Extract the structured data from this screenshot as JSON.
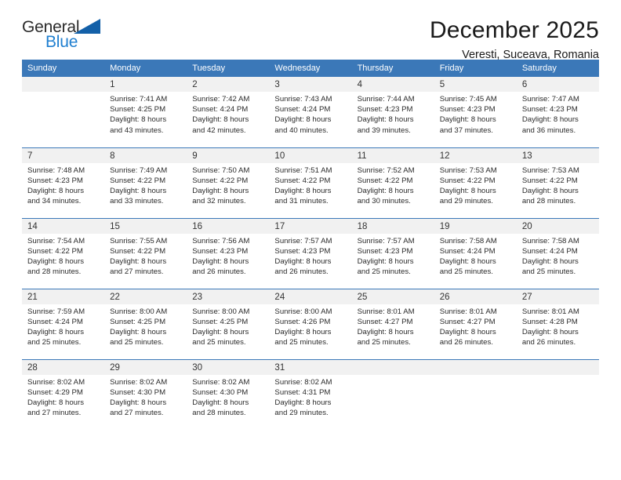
{
  "logo": {
    "word_top": "General",
    "word_bottom": "Blue",
    "icon": "blue-triangle-flag"
  },
  "header": {
    "title": "December 2025",
    "subtitle": "Veresti, Suceava, Romania"
  },
  "colors": {
    "header_blue": "#3b78b8",
    "logo_blue": "#1f7fd0",
    "daynum_band": "#f1f1f1"
  },
  "weekday_headers": [
    "Sunday",
    "Monday",
    "Tuesday",
    "Wednesday",
    "Thursday",
    "Friday",
    "Saturday"
  ],
  "weeks": [
    [
      {
        "day": "",
        "sunrise": "",
        "sunset": "",
        "daylight_l1": "",
        "daylight_l2": ""
      },
      {
        "day": "1",
        "sunrise": "Sunrise: 7:41 AM",
        "sunset": "Sunset: 4:25 PM",
        "daylight_l1": "Daylight: 8 hours",
        "daylight_l2": "and 43 minutes."
      },
      {
        "day": "2",
        "sunrise": "Sunrise: 7:42 AM",
        "sunset": "Sunset: 4:24 PM",
        "daylight_l1": "Daylight: 8 hours",
        "daylight_l2": "and 42 minutes."
      },
      {
        "day": "3",
        "sunrise": "Sunrise: 7:43 AM",
        "sunset": "Sunset: 4:24 PM",
        "daylight_l1": "Daylight: 8 hours",
        "daylight_l2": "and 40 minutes."
      },
      {
        "day": "4",
        "sunrise": "Sunrise: 7:44 AM",
        "sunset": "Sunset: 4:23 PM",
        "daylight_l1": "Daylight: 8 hours",
        "daylight_l2": "and 39 minutes."
      },
      {
        "day": "5",
        "sunrise": "Sunrise: 7:45 AM",
        "sunset": "Sunset: 4:23 PM",
        "daylight_l1": "Daylight: 8 hours",
        "daylight_l2": "and 37 minutes."
      },
      {
        "day": "6",
        "sunrise": "Sunrise: 7:47 AM",
        "sunset": "Sunset: 4:23 PM",
        "daylight_l1": "Daylight: 8 hours",
        "daylight_l2": "and 36 minutes."
      }
    ],
    [
      {
        "day": "7",
        "sunrise": "Sunrise: 7:48 AM",
        "sunset": "Sunset: 4:23 PM",
        "daylight_l1": "Daylight: 8 hours",
        "daylight_l2": "and 34 minutes."
      },
      {
        "day": "8",
        "sunrise": "Sunrise: 7:49 AM",
        "sunset": "Sunset: 4:22 PM",
        "daylight_l1": "Daylight: 8 hours",
        "daylight_l2": "and 33 minutes."
      },
      {
        "day": "9",
        "sunrise": "Sunrise: 7:50 AM",
        "sunset": "Sunset: 4:22 PM",
        "daylight_l1": "Daylight: 8 hours",
        "daylight_l2": "and 32 minutes."
      },
      {
        "day": "10",
        "sunrise": "Sunrise: 7:51 AM",
        "sunset": "Sunset: 4:22 PM",
        "daylight_l1": "Daylight: 8 hours",
        "daylight_l2": "and 31 minutes."
      },
      {
        "day": "11",
        "sunrise": "Sunrise: 7:52 AM",
        "sunset": "Sunset: 4:22 PM",
        "daylight_l1": "Daylight: 8 hours",
        "daylight_l2": "and 30 minutes."
      },
      {
        "day": "12",
        "sunrise": "Sunrise: 7:53 AM",
        "sunset": "Sunset: 4:22 PM",
        "daylight_l1": "Daylight: 8 hours",
        "daylight_l2": "and 29 minutes."
      },
      {
        "day": "13",
        "sunrise": "Sunrise: 7:53 AM",
        "sunset": "Sunset: 4:22 PM",
        "daylight_l1": "Daylight: 8 hours",
        "daylight_l2": "and 28 minutes."
      }
    ],
    [
      {
        "day": "14",
        "sunrise": "Sunrise: 7:54 AM",
        "sunset": "Sunset: 4:22 PM",
        "daylight_l1": "Daylight: 8 hours",
        "daylight_l2": "and 28 minutes."
      },
      {
        "day": "15",
        "sunrise": "Sunrise: 7:55 AM",
        "sunset": "Sunset: 4:22 PM",
        "daylight_l1": "Daylight: 8 hours",
        "daylight_l2": "and 27 minutes."
      },
      {
        "day": "16",
        "sunrise": "Sunrise: 7:56 AM",
        "sunset": "Sunset: 4:23 PM",
        "daylight_l1": "Daylight: 8 hours",
        "daylight_l2": "and 26 minutes."
      },
      {
        "day": "17",
        "sunrise": "Sunrise: 7:57 AM",
        "sunset": "Sunset: 4:23 PM",
        "daylight_l1": "Daylight: 8 hours",
        "daylight_l2": "and 26 minutes."
      },
      {
        "day": "18",
        "sunrise": "Sunrise: 7:57 AM",
        "sunset": "Sunset: 4:23 PM",
        "daylight_l1": "Daylight: 8 hours",
        "daylight_l2": "and 25 minutes."
      },
      {
        "day": "19",
        "sunrise": "Sunrise: 7:58 AM",
        "sunset": "Sunset: 4:24 PM",
        "daylight_l1": "Daylight: 8 hours",
        "daylight_l2": "and 25 minutes."
      },
      {
        "day": "20",
        "sunrise": "Sunrise: 7:58 AM",
        "sunset": "Sunset: 4:24 PM",
        "daylight_l1": "Daylight: 8 hours",
        "daylight_l2": "and 25 minutes."
      }
    ],
    [
      {
        "day": "21",
        "sunrise": "Sunrise: 7:59 AM",
        "sunset": "Sunset: 4:24 PM",
        "daylight_l1": "Daylight: 8 hours",
        "daylight_l2": "and 25 minutes."
      },
      {
        "day": "22",
        "sunrise": "Sunrise: 8:00 AM",
        "sunset": "Sunset: 4:25 PM",
        "daylight_l1": "Daylight: 8 hours",
        "daylight_l2": "and 25 minutes."
      },
      {
        "day": "23",
        "sunrise": "Sunrise: 8:00 AM",
        "sunset": "Sunset: 4:25 PM",
        "daylight_l1": "Daylight: 8 hours",
        "daylight_l2": "and 25 minutes."
      },
      {
        "day": "24",
        "sunrise": "Sunrise: 8:00 AM",
        "sunset": "Sunset: 4:26 PM",
        "daylight_l1": "Daylight: 8 hours",
        "daylight_l2": "and 25 minutes."
      },
      {
        "day": "25",
        "sunrise": "Sunrise: 8:01 AM",
        "sunset": "Sunset: 4:27 PM",
        "daylight_l1": "Daylight: 8 hours",
        "daylight_l2": "and 25 minutes."
      },
      {
        "day": "26",
        "sunrise": "Sunrise: 8:01 AM",
        "sunset": "Sunset: 4:27 PM",
        "daylight_l1": "Daylight: 8 hours",
        "daylight_l2": "and 26 minutes."
      },
      {
        "day": "27",
        "sunrise": "Sunrise: 8:01 AM",
        "sunset": "Sunset: 4:28 PM",
        "daylight_l1": "Daylight: 8 hours",
        "daylight_l2": "and 26 minutes."
      }
    ],
    [
      {
        "day": "28",
        "sunrise": "Sunrise: 8:02 AM",
        "sunset": "Sunset: 4:29 PM",
        "daylight_l1": "Daylight: 8 hours",
        "daylight_l2": "and 27 minutes."
      },
      {
        "day": "29",
        "sunrise": "Sunrise: 8:02 AM",
        "sunset": "Sunset: 4:30 PM",
        "daylight_l1": "Daylight: 8 hours",
        "daylight_l2": "and 27 minutes."
      },
      {
        "day": "30",
        "sunrise": "Sunrise: 8:02 AM",
        "sunset": "Sunset: 4:30 PM",
        "daylight_l1": "Daylight: 8 hours",
        "daylight_l2": "and 28 minutes."
      },
      {
        "day": "31",
        "sunrise": "Sunrise: 8:02 AM",
        "sunset": "Sunset: 4:31 PM",
        "daylight_l1": "Daylight: 8 hours",
        "daylight_l2": "and 29 minutes."
      },
      {
        "day": "",
        "sunrise": "",
        "sunset": "",
        "daylight_l1": "",
        "daylight_l2": ""
      },
      {
        "day": "",
        "sunrise": "",
        "sunset": "",
        "daylight_l1": "",
        "daylight_l2": ""
      },
      {
        "day": "",
        "sunrise": "",
        "sunset": "",
        "daylight_l1": "",
        "daylight_l2": ""
      }
    ]
  ]
}
